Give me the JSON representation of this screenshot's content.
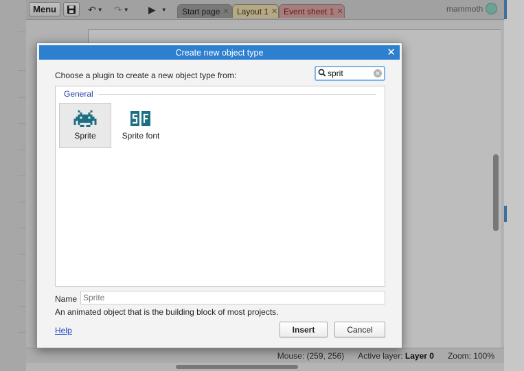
{
  "toolbar": {
    "menu_label": "Menu",
    "icons": [
      "save-icon",
      "undo-icon",
      "redo-icon",
      "play-icon"
    ],
    "tabs": [
      {
        "label": "Start page",
        "color": "#9c9c9c"
      },
      {
        "label": "Layout 1",
        "color": "#ead9a6",
        "active": true
      },
      {
        "label": "Event sheet 1",
        "color": "#d9a0a0"
      }
    ],
    "user": "mammoth"
  },
  "dialog": {
    "title": "Create new object type",
    "prompt": "Choose a plugin to create a new object type from:",
    "search": {
      "value": "sprit"
    },
    "group_label": "General",
    "plugins": [
      {
        "label": "Sprite",
        "icon": "sprite-invader-icon",
        "selected": true
      },
      {
        "label": "Sprite font",
        "icon": "sprite-font-icon",
        "selected": false
      }
    ],
    "name_label": "Name",
    "name_placeholder": "Sprite",
    "description": "An animated object that is the building block of most projects.",
    "help_label": "Help",
    "insert_label": "Insert",
    "cancel_label": "Cancel"
  },
  "statusbar": {
    "mouse_label": "Mouse:",
    "mouse_value": "(259, 256)",
    "active_layer_label": "Active layer:",
    "active_layer_value": "Layer 0",
    "zoom_label": "Zoom:",
    "zoom_value": "100%"
  },
  "colors": {
    "title_bar": "#2d7fd0",
    "group_label": "#2a3ea8",
    "plugin_icon": "#1d6f82",
    "link": "#1a3fc0"
  }
}
